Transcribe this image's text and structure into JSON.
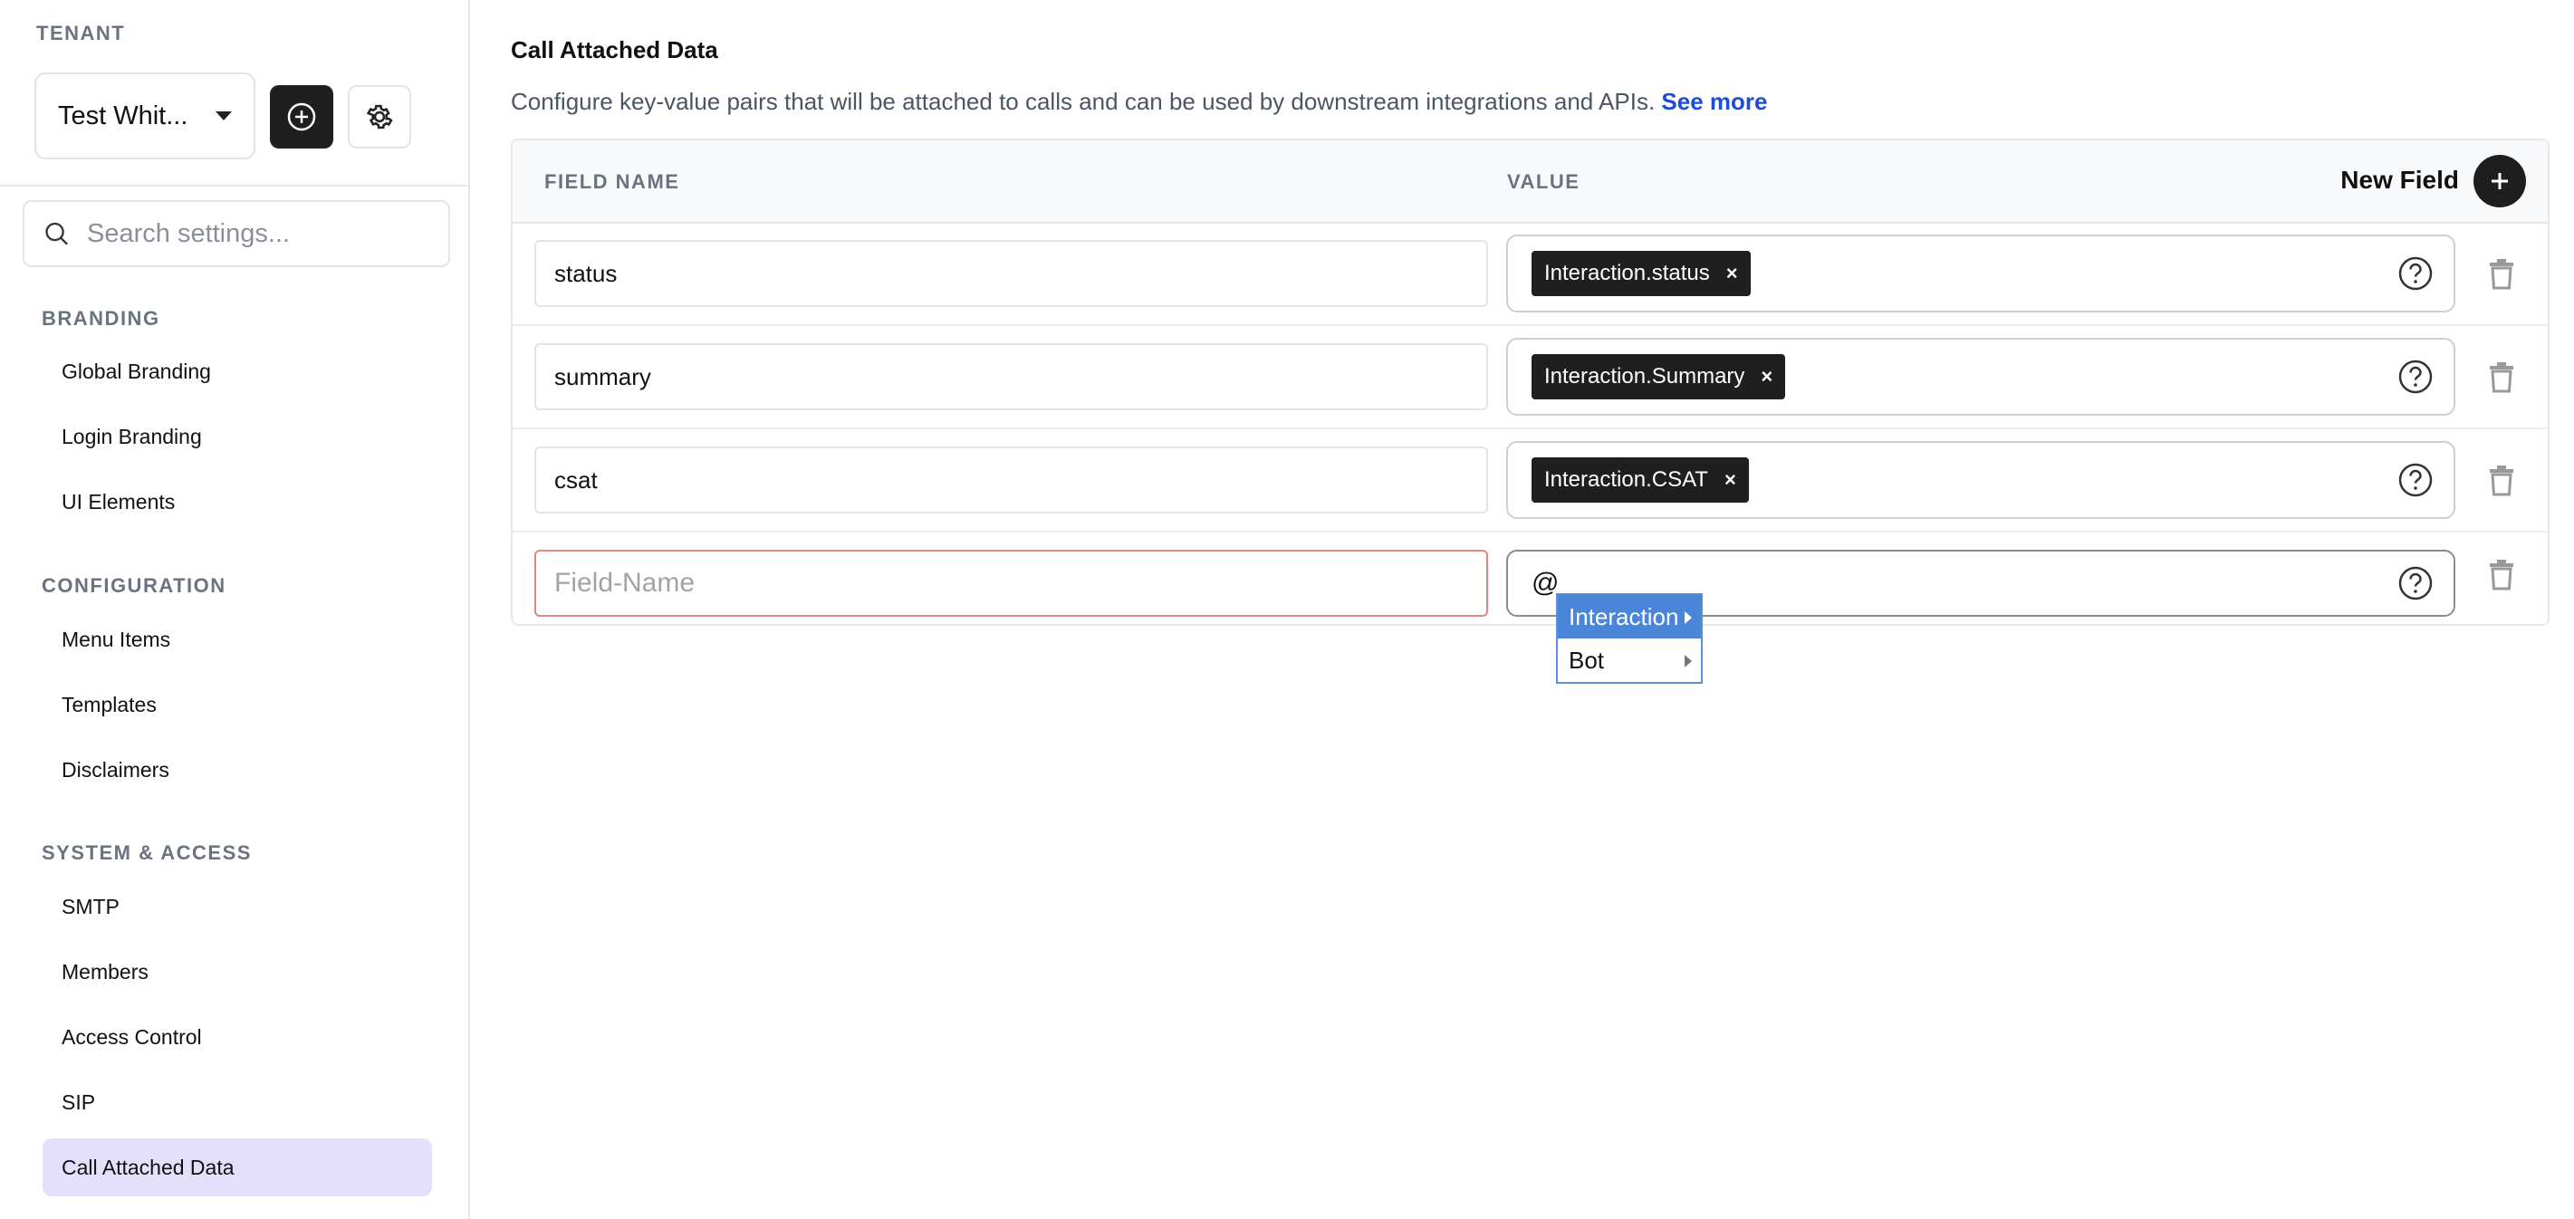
{
  "sidebar": {
    "tenant_label": "TENANT",
    "tenant_value": "Test Whit...",
    "search_placeholder": "Search settings...",
    "sections": [
      {
        "label": "BRANDING",
        "items": [
          "Global Branding",
          "Login Branding",
          "UI Elements"
        ]
      },
      {
        "label": "CONFIGURATION",
        "items": [
          "Menu Items",
          "Templates",
          "Disclaimers"
        ]
      },
      {
        "label": "SYSTEM & ACCESS",
        "items": [
          "SMTP",
          "Members",
          "Access Control",
          "SIP",
          "Call Attached Data"
        ]
      }
    ],
    "active_item": "Call Attached Data"
  },
  "main": {
    "title": "Call Attached Data",
    "description": "Configure key-value pairs that will be attached to calls and can be used by downstream integrations and APIs.",
    "see_more": "See more",
    "table": {
      "col_field_name": "FIELD NAME",
      "col_value": "VALUE",
      "new_field_label": "New Field",
      "rows": [
        {
          "field": "status",
          "value_chip": "Interaction.status"
        },
        {
          "field": "summary",
          "value_chip": "Interaction.Summary"
        },
        {
          "field": "csat",
          "value_chip": "Interaction.CSAT"
        }
      ],
      "new_row": {
        "field_placeholder": "Field-Name",
        "value_text": "@"
      }
    },
    "autocomplete": {
      "items": [
        "Interaction",
        "Bot"
      ],
      "highlighted": "Interaction"
    }
  },
  "icons": {
    "add_tenant": "plus-circle-icon",
    "tenant_settings": "gear-icon",
    "search": "search-icon",
    "new_field": "plus-icon",
    "help": "question-circle-icon",
    "delete": "trash-icon"
  },
  "colors": {
    "active_nav_bg": "#e4e0fb",
    "link": "#1d4ed8",
    "chip_bg": "#1f1f1f",
    "error_border": "#e2877f",
    "dropdown_highlight": "#4a86d8"
  }
}
